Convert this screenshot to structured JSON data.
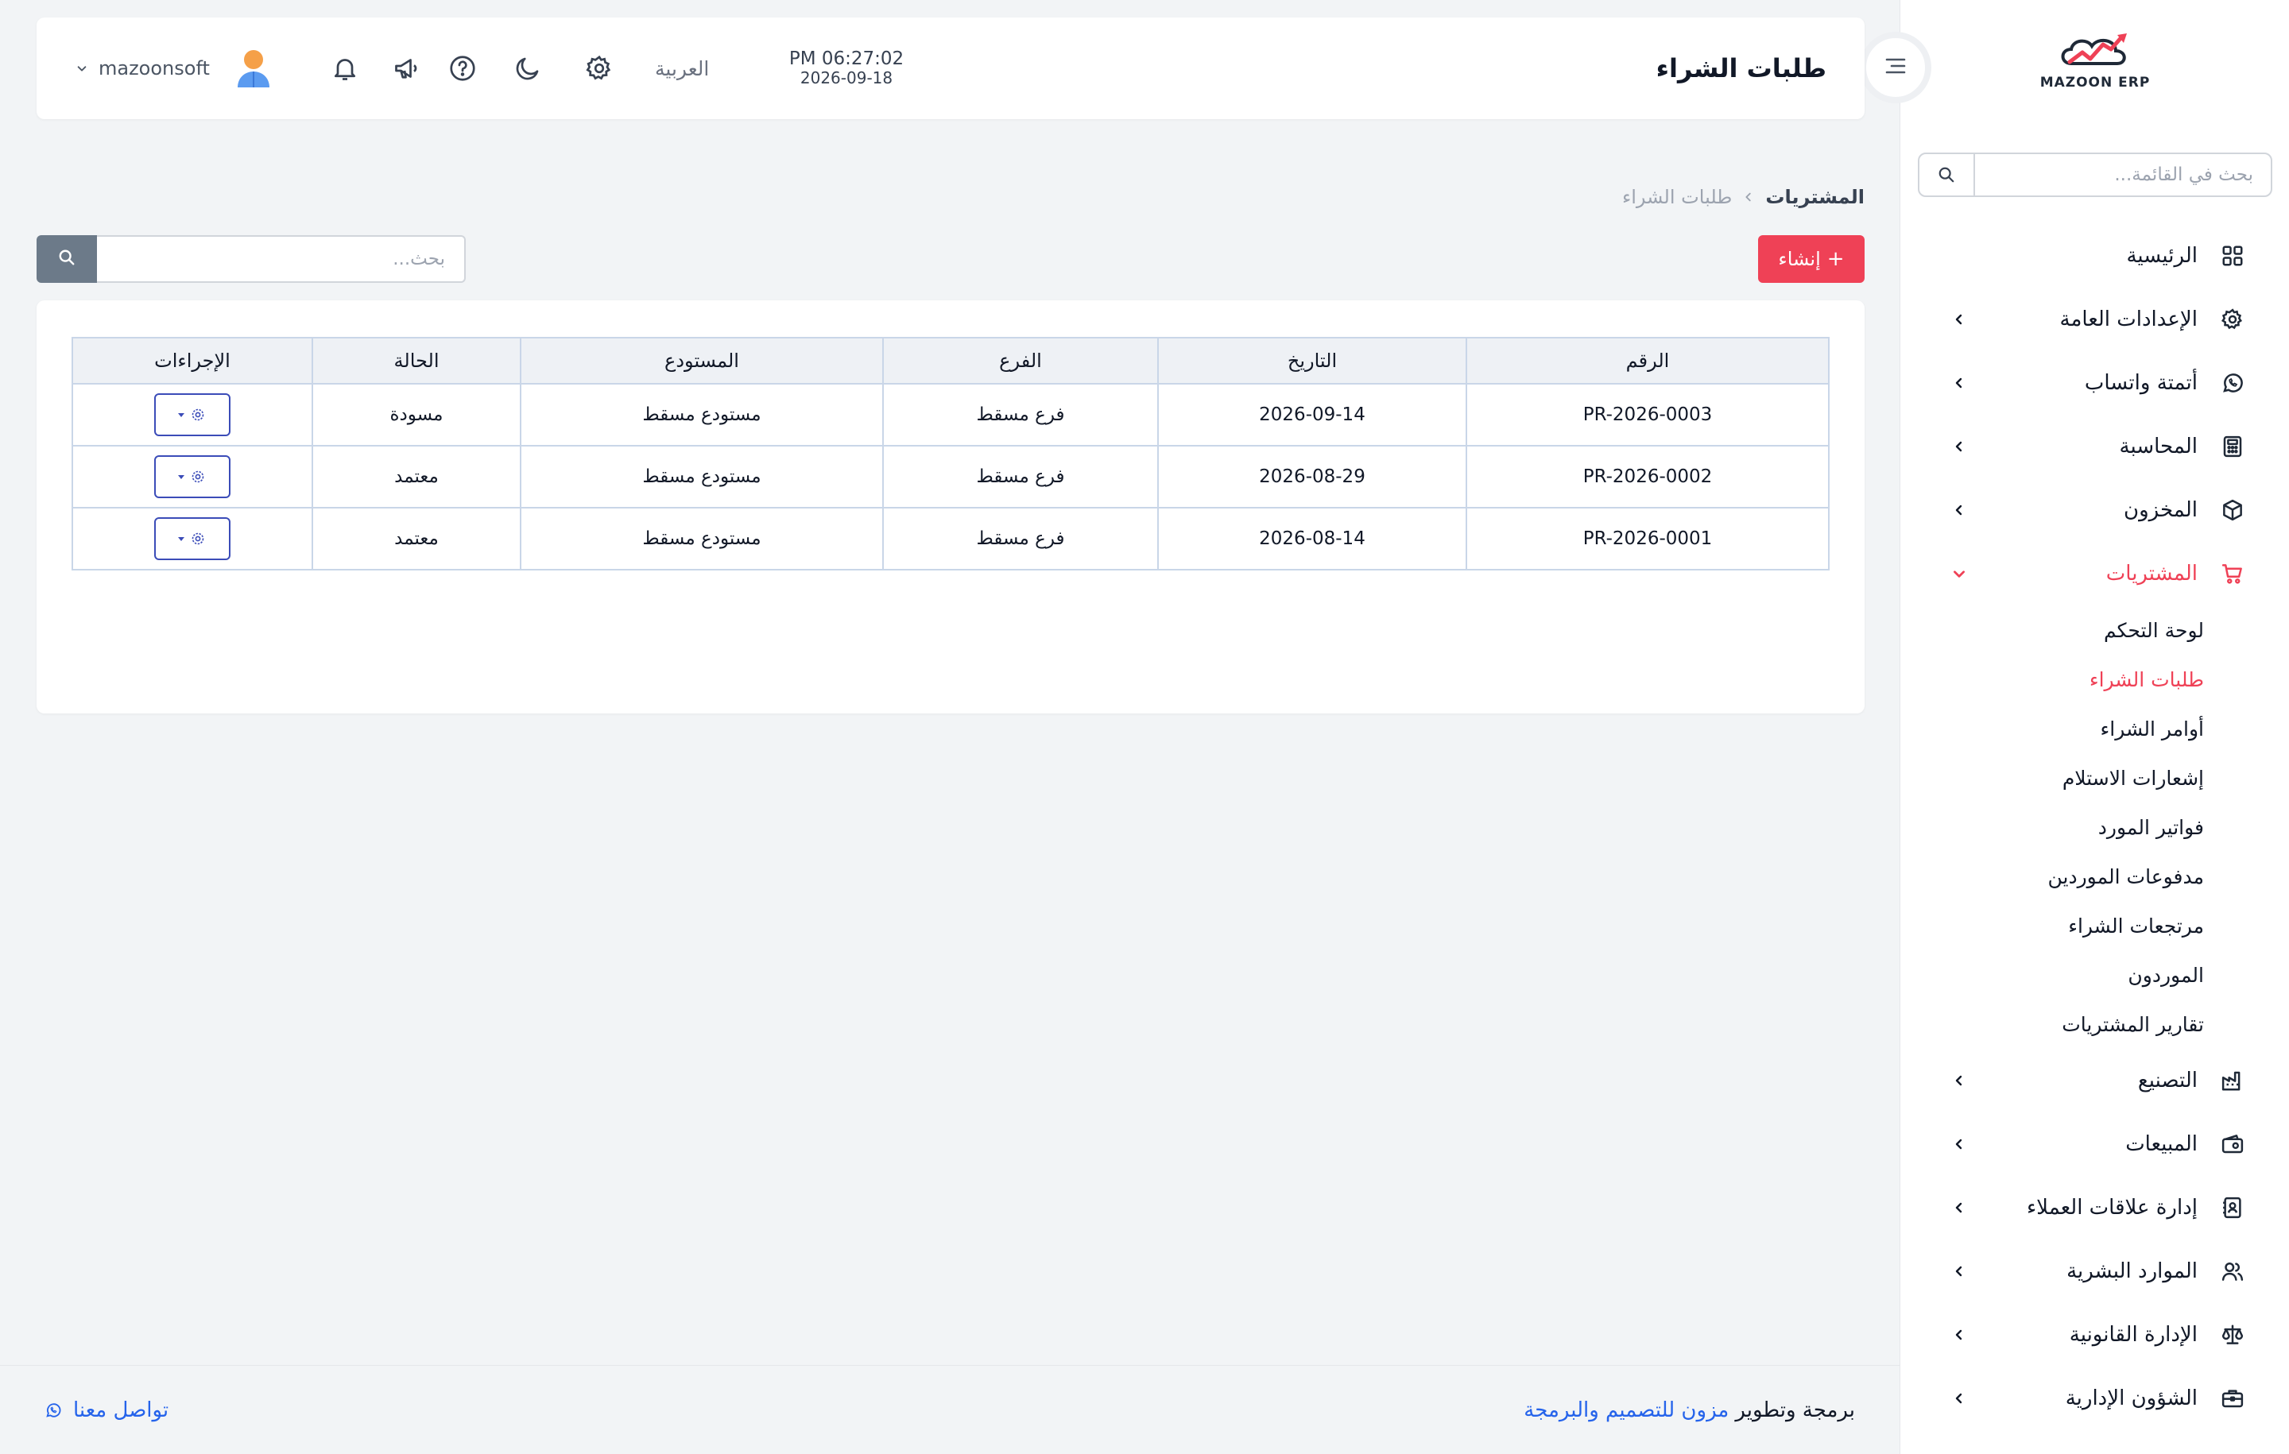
{
  "app": {
    "logo_text": "MAZOON ERP",
    "brand_color": "#ef4156"
  },
  "header": {
    "title": "طلبات الشراء",
    "time": "PM 06:27:02",
    "date": "2026-09-18",
    "language": "العربية",
    "username": "mazoonsoft",
    "icons": [
      "settings-icon",
      "dark-mode-icon",
      "help-icon",
      "announcement-icon",
      "notification-icon"
    ]
  },
  "sidebar": {
    "search_placeholder": "بحث في القائمة...",
    "items": [
      {
        "label": "الرئيسية",
        "icon": "dashboard-icon"
      },
      {
        "label": "الإعدادات العامة",
        "icon": "gear-icon"
      },
      {
        "label": "أتمتة واتساب",
        "icon": "whatsapp-icon"
      },
      {
        "label": "المحاسبة",
        "icon": "calculator-icon"
      },
      {
        "label": "المخزون",
        "icon": "box-icon"
      },
      {
        "label": "المشتريات",
        "icon": "cart-icon",
        "active": true
      },
      {
        "label": "التصنيع",
        "icon": "factory-icon"
      },
      {
        "label": "المبيعات",
        "icon": "wallet-icon"
      },
      {
        "label": "إدارة علاقات العملاء",
        "icon": "contacts-icon"
      },
      {
        "label": "الموارد البشرية",
        "icon": "users-icon"
      },
      {
        "label": "الإدارة القانونية",
        "icon": "scale-icon"
      },
      {
        "label": "الشؤون الإدارية",
        "icon": "briefcase-icon"
      }
    ],
    "purchases_submenu": [
      {
        "label": "لوحة التحكم"
      },
      {
        "label": "طلبات الشراء",
        "active": true
      },
      {
        "label": "أوامر الشراء"
      },
      {
        "label": "إشعارات الاستلام"
      },
      {
        "label": "فواتير المورد"
      },
      {
        "label": "مدفوعات الموردين"
      },
      {
        "label": "مرتجعات الشراء"
      },
      {
        "label": "الموردون"
      },
      {
        "label": "تقارير المشتريات"
      }
    ]
  },
  "breadcrumb": {
    "parent": "المشتريات",
    "current": "طلبات الشراء"
  },
  "toolbar": {
    "create_label": "إنشاء",
    "search_placeholder": "بحث..."
  },
  "table": {
    "headers": [
      "الرقم",
      "التاريخ",
      "الفرع",
      "المستودع",
      "الحالة",
      "الإجراءات"
    ],
    "rows": [
      {
        "number": "PR-2026-0003",
        "date": "2026-09-14",
        "branch": "فرع مسقط",
        "warehouse": "مستودع مسقط",
        "status": "مسودة"
      },
      {
        "number": "PR-2026-0002",
        "date": "2026-08-29",
        "branch": "فرع مسقط",
        "warehouse": "مستودع مسقط",
        "status": "معتمد"
      },
      {
        "number": "PR-2026-0001",
        "date": "2026-08-14",
        "branch": "فرع مسقط",
        "warehouse": "مستودع مسقط",
        "status": "معتمد"
      }
    ]
  },
  "footer": {
    "credit_prefix": "برمجة وتطوير",
    "credit_company": "مزون للتصميم والبرمجة",
    "contact_label": "تواصل معنا"
  }
}
